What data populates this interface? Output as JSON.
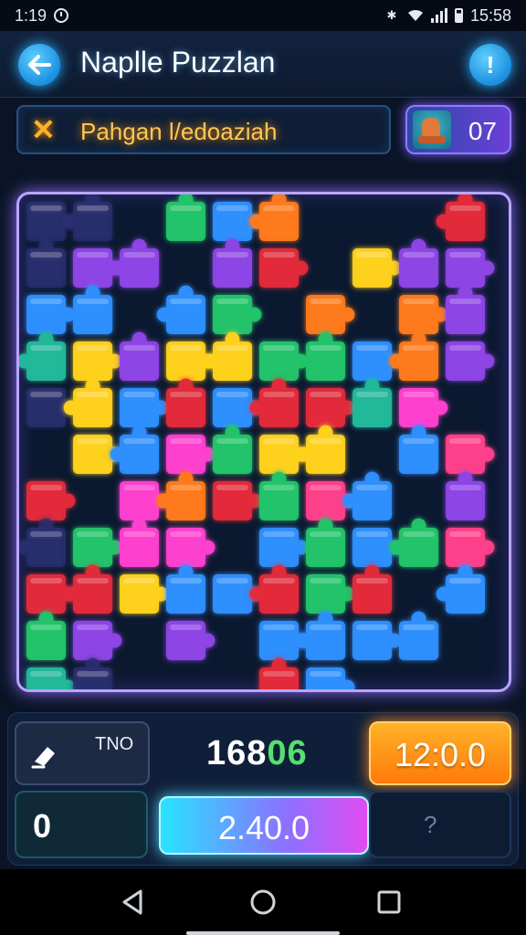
{
  "status_bar": {
    "time_left": "1:19",
    "time_right": "15:58",
    "icons": [
      "clock-icon",
      "bluetooth-icon",
      "wifi-icon",
      "signal-icon",
      "battery-icon"
    ]
  },
  "header": {
    "title": "Naplle Puzzlan",
    "back_icon": "arrow-left-icon",
    "info_icon": "exclamation-icon"
  },
  "target_bar": {
    "icon": "x-icon",
    "text": "Pahgan l/edoaziah"
  },
  "counter": {
    "value": "07",
    "image": "character-avatar"
  },
  "board": {
    "colors": {
      "red": "#e32a3a",
      "orange": "#ff7a1a",
      "yellow": "#ffd21f",
      "green": "#22c46a",
      "teal": "#22b89a",
      "blue": "#2e8fff",
      "cyan": "#20c0e8",
      "purple": "#8e44e6",
      "magenta": "#ff3fd0",
      "pink": "#ff3f8a",
      "dim": "#2a2f70"
    },
    "grid": [
      [
        "dim",
        "dim",
        "",
        "green",
        "blue",
        "orange",
        "",
        "",
        "",
        "red"
      ],
      [
        "dim",
        "purple",
        "purple",
        "",
        "purple",
        "red",
        "",
        "yellow",
        "purple",
        "purple"
      ],
      [
        "blue",
        "blue",
        "",
        "blue",
        "green",
        "",
        "orange",
        "",
        "orange",
        "purple"
      ],
      [
        "teal",
        "yellow",
        "purple",
        "yellow",
        "yellow",
        "green",
        "green",
        "blue",
        "orange",
        "purple"
      ],
      [
        "dim",
        "yellow",
        "blue",
        "red",
        "blue",
        "red",
        "red",
        "teal",
        "magenta",
        ""
      ],
      [
        "",
        "yellow",
        "blue",
        "magenta",
        "green",
        "yellow",
        "yellow",
        "",
        "blue",
        "pink"
      ],
      [
        "red",
        "",
        "magenta",
        "orange",
        "red",
        "green",
        "pink",
        "blue",
        "",
        "purple"
      ],
      [
        "dim",
        "green",
        "magenta",
        "magenta",
        "",
        "blue",
        "green",
        "blue",
        "green",
        "pink"
      ],
      [
        "red",
        "red",
        "yellow",
        "blue",
        "blue",
        "red",
        "green",
        "red",
        "",
        "blue"
      ],
      [
        "green",
        "purple",
        "",
        "purple",
        "",
        "blue",
        "blue",
        "blue",
        "blue",
        ""
      ],
      [
        "teal",
        "dim",
        "",
        "",
        "",
        "red",
        "blue",
        "",
        "",
        ""
      ]
    ]
  },
  "bottom": {
    "tool_label": "TNO",
    "tool_icon": "eraser-icon",
    "score_lead": "168",
    "score_tail": "06",
    "timer": "12:0.0",
    "left_value": "0",
    "progress_value": "2.40.0",
    "help_glyph": "?"
  },
  "nav": {
    "icons": [
      "back-triangle-icon",
      "home-circle-icon",
      "recent-square-icon"
    ]
  }
}
